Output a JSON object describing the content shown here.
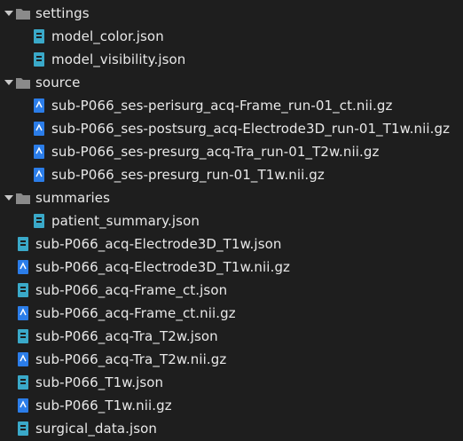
{
  "tree": {
    "settings_folder": "settings",
    "settings_items": [
      "model_color.json",
      "model_visibility.json"
    ],
    "source_folder": "source",
    "source_items": [
      "sub-P066_ses-perisurg_acq-Frame_run-01_ct.nii.gz",
      "sub-P066_ses-postsurg_acq-Electrode3D_run-01_T1w.nii.gz",
      "sub-P066_ses-presurg_acq-Tra_run-01_T2w.nii.gz",
      "sub-P066_ses-presurg_run-01_T1w.nii.gz"
    ],
    "summaries_folder": "summaries",
    "summaries_items": [
      "patient_summary.json"
    ],
    "root_files": [
      "sub-P066_acq-Electrode3D_T1w.json",
      "sub-P066_acq-Electrode3D_T1w.nii.gz",
      "sub-P066_acq-Frame_ct.json",
      "sub-P066_acq-Frame_ct.nii.gz",
      "sub-P066_acq-Tra_T2w.json",
      "sub-P066_acq-Tra_T2w.nii.gz",
      "sub-P066_T1w.json",
      "sub-P066_T1w.nii.gz",
      "surgical_data.json"
    ]
  },
  "icons": {
    "folder": "folder-icon",
    "json": "json-file-icon",
    "archive": "archive-file-icon"
  },
  "colors": {
    "background": "#1e1e1e",
    "text": "#e8e8e8",
    "folder": "#8a8a8a",
    "json_icon": "#3aa9c9",
    "archive_icon": "#2b7de9"
  }
}
